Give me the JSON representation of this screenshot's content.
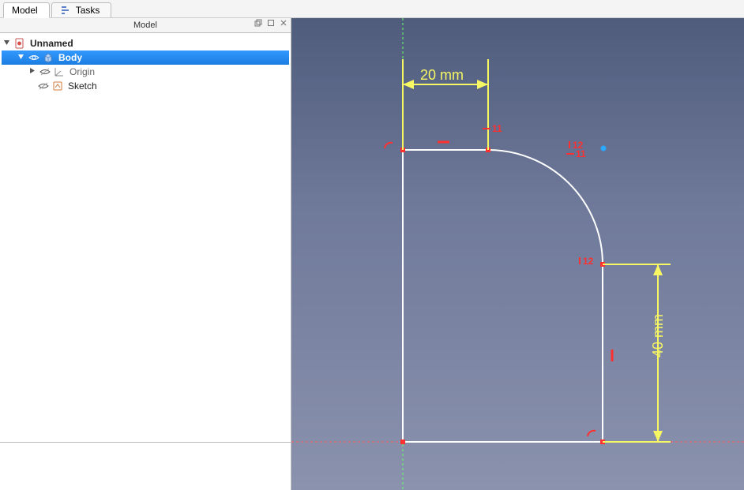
{
  "tabs": {
    "model": "Model",
    "tasks": "Tasks"
  },
  "panel": {
    "title": "Model"
  },
  "tree": {
    "root": {
      "label": "Unnamed"
    },
    "body": {
      "label": "Body"
    },
    "origin": {
      "label": "Origin"
    },
    "sketch": {
      "label": "Sketch"
    }
  },
  "sketch": {
    "dim_horizontal": "20 mm",
    "dim_vertical": "40 mm",
    "constraints": {
      "top_line": "11",
      "upper_right_a": "12",
      "upper_right_b": "11",
      "arc_end": "12",
      "mid_vert": ""
    }
  },
  "colors": {
    "selection": "#2a8ef0",
    "dim": "#f7f763",
    "constraint": "#ff3030",
    "geom": "#ffffff",
    "vertex": "#ff2a2a",
    "axis_x": "#ff4d4d",
    "axis_y": "#4dff4d",
    "cursor_point": "#2aa9ff"
  }
}
